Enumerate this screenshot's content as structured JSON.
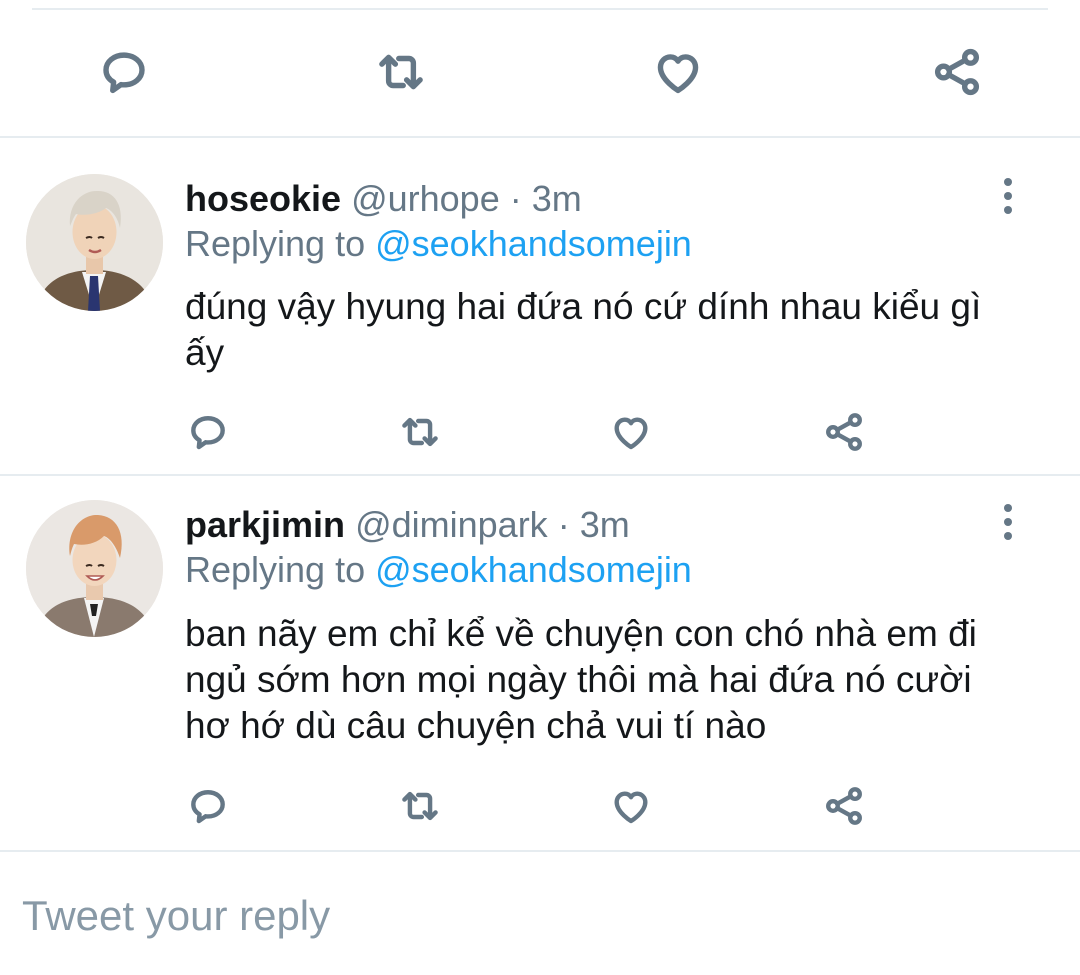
{
  "tweets": [
    {
      "display_name": "hoseokie",
      "handle": "@urhope",
      "separator": "·",
      "time": "3m",
      "replying_prefix": "Replying to ",
      "replying_to": "@seokhandsomejin",
      "text": "đúng vậy hyung hai đứa nó cứ dính nhau kiểu gì ấy"
    },
    {
      "display_name": "parkjimin",
      "handle": "@diminpark",
      "separator": "·",
      "time": "3m",
      "replying_prefix": "Replying to ",
      "replying_to": "@seokhandsomejin",
      "text": "ban nãy em chỉ kể về chuyện con chó nhà em đi ngủ sớm hơn mọi ngày thôi mà hai đứa nó cười hơ hớ dù câu chuyện chả vui tí nào"
    }
  ],
  "composer": {
    "placeholder": "Tweet your reply"
  },
  "colors": {
    "icon": "#657786",
    "link": "#1da1f2",
    "divider": "#e6ecf0",
    "text": "#14171a"
  },
  "icons": [
    "reply-icon",
    "retweet-icon",
    "like-icon",
    "share-icon",
    "more-icon"
  ]
}
